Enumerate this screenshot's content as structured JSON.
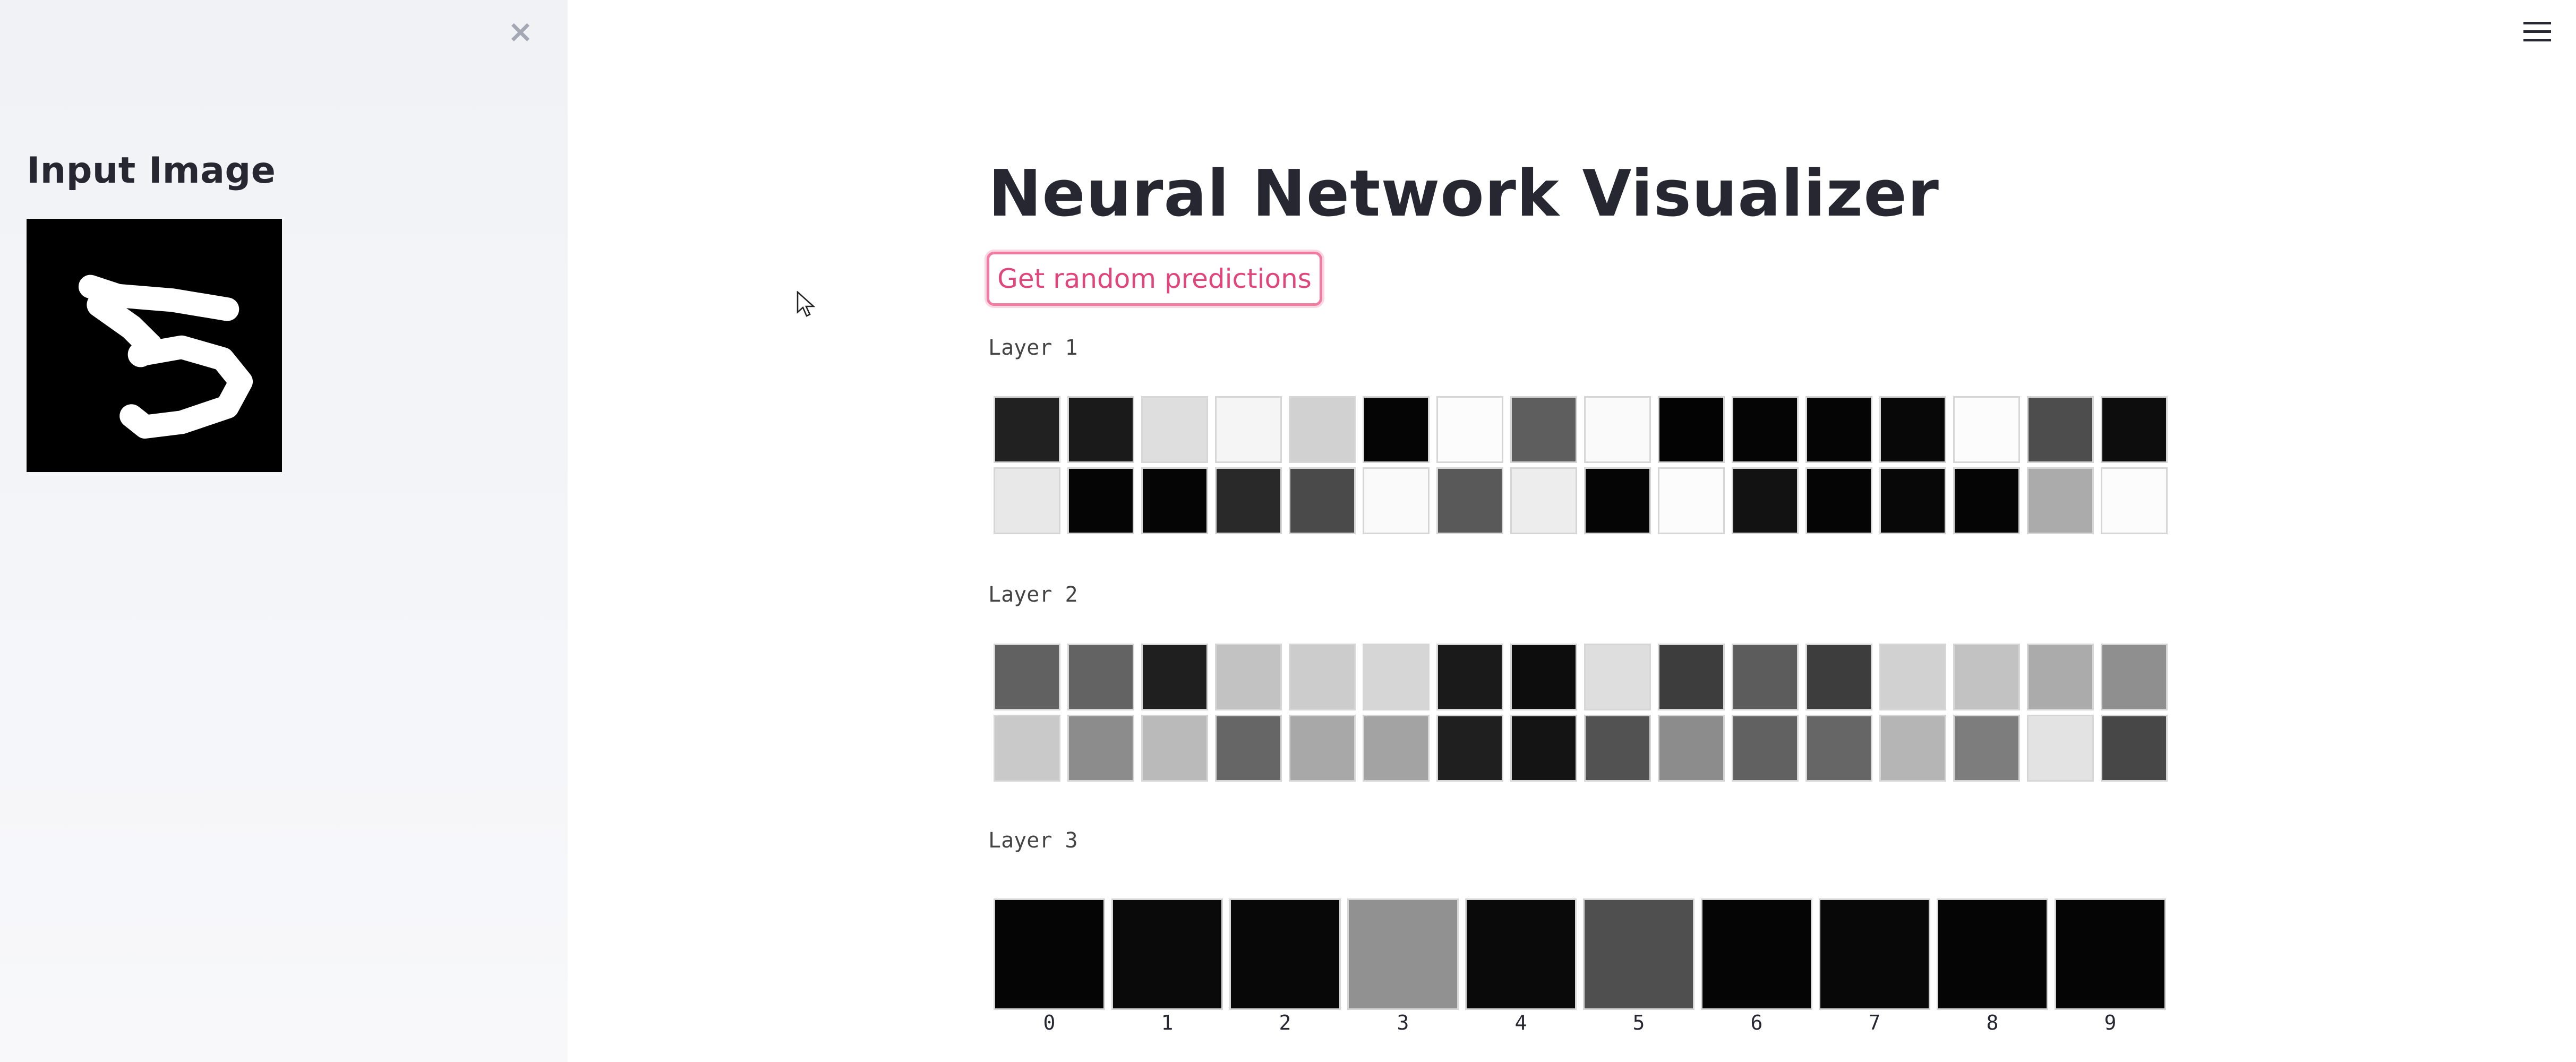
{
  "sidebar": {
    "title": "Input Image",
    "close_icon": "close-icon"
  },
  "header": {
    "menu_icon": "hamburger-menu-icon"
  },
  "main": {
    "title": "Neural Network Visualizer",
    "button_label": "Get random predictions"
  },
  "layers": [
    {
      "label": "Layer 1",
      "activations": [
        0.13,
        0.1,
        0.87,
        0.96,
        0.82,
        0.02,
        0.99,
        0.37,
        0.98,
        0.01,
        0.02,
        0.02,
        0.03,
        0.99,
        0.3,
        0.05,
        0.91,
        0.02,
        0.02,
        0.16,
        0.29,
        0.98,
        0.35,
        0.93,
        0.02,
        0.99,
        0.07,
        0.02,
        0.03,
        0.02,
        0.67,
        0.99
      ]
    },
    {
      "label": "Layer 2",
      "activations": [
        0.38,
        0.39,
        0.12,
        0.76,
        0.8,
        0.84,
        0.1,
        0.05,
        0.87,
        0.24,
        0.36,
        0.24,
        0.82,
        0.76,
        0.67,
        0.56,
        0.79,
        0.55,
        0.73,
        0.4,
        0.66,
        0.64,
        0.12,
        0.08,
        0.32,
        0.55,
        0.38,
        0.4,
        0.71,
        0.49,
        0.89,
        0.28
      ]
    },
    {
      "label": "Layer 3",
      "outputs": [
        {
          "label": "0",
          "activation": 0.02
        },
        {
          "label": "1",
          "activation": 0.04
        },
        {
          "label": "2",
          "activation": 0.03
        },
        {
          "label": "3",
          "activation": 0.57
        },
        {
          "label": "4",
          "activation": 0.04
        },
        {
          "label": "5",
          "activation": 0.31
        },
        {
          "label": "6",
          "activation": 0.02
        },
        {
          "label": "7",
          "activation": 0.03
        },
        {
          "label": "8",
          "activation": 0.02
        },
        {
          "label": "9",
          "activation": 0.02
        }
      ]
    }
  ]
}
